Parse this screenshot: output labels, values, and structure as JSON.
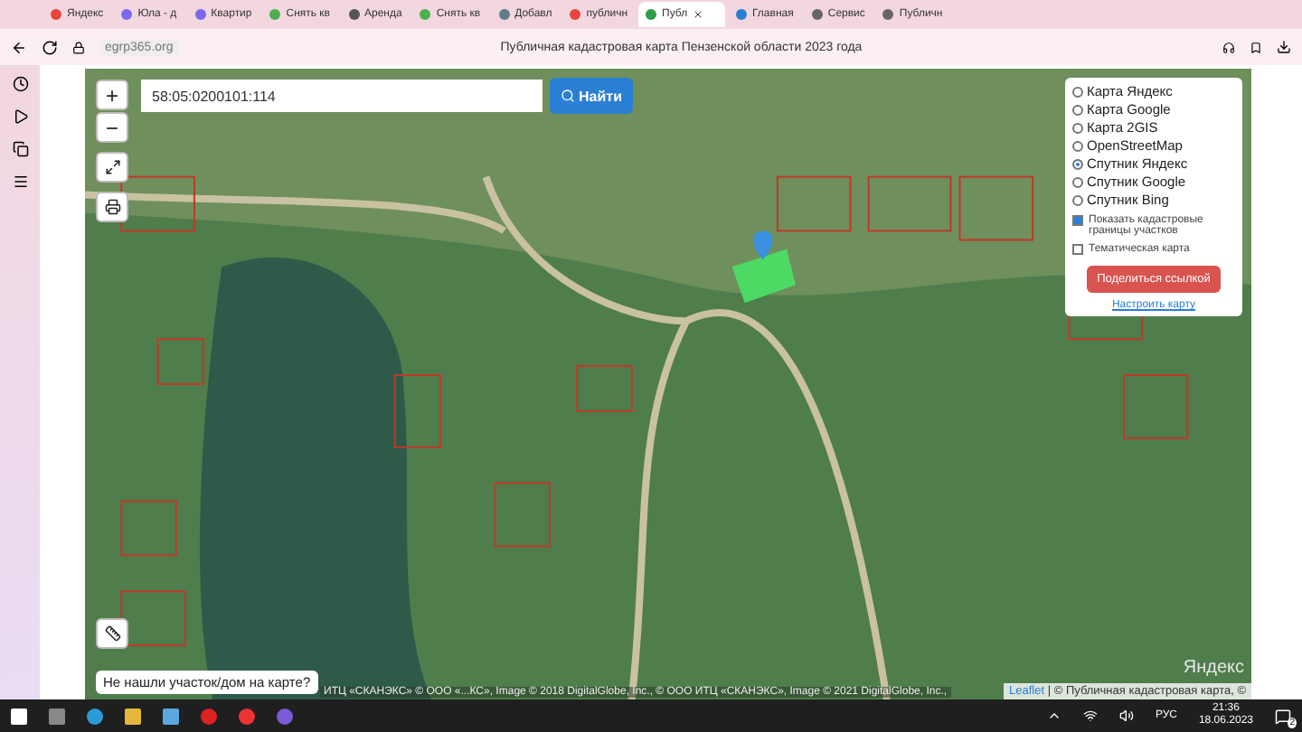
{
  "browser": {
    "tabs": [
      {
        "label": "Яндекс",
        "selected": false,
        "color": "#e8453c"
      },
      {
        "label": "Юла - д",
        "selected": false,
        "color": "#7b68ee"
      },
      {
        "label": "Квартир",
        "selected": false,
        "color": "#7b68ee"
      },
      {
        "label": "Снять кв",
        "selected": false,
        "color": "#4caf50"
      },
      {
        "label": "Аренда",
        "selected": false,
        "color": "#555555"
      },
      {
        "label": "Снять кв",
        "selected": false,
        "color": "#4caf50"
      },
      {
        "label": "Добавл",
        "selected": false,
        "color": "#607d8b"
      },
      {
        "label": "публичн",
        "selected": false,
        "color": "#e8453c"
      },
      {
        "label": "Публ",
        "selected": true,
        "color": "#2e9d4a"
      },
      {
        "label": "Главная",
        "selected": false,
        "color": "#2a7fd4"
      },
      {
        "label": "Сервис",
        "selected": false,
        "color": "#666666"
      },
      {
        "label": "Публичн",
        "selected": false,
        "color": "#666666"
      }
    ],
    "address": "egrp365.org",
    "page_title": "Публичная кадастровая карта Пензенской области 2023 года"
  },
  "map": {
    "search": {
      "value": "58:05:0200101:114",
      "button": "Найти"
    },
    "zoom_in": "+",
    "zoom_out": "−",
    "layers": [
      {
        "label": "Карта Яндекс",
        "selected": false
      },
      {
        "label": "Карта Google",
        "selected": false
      },
      {
        "label": "Карта 2GIS",
        "selected": false
      },
      {
        "label": "OpenStreetMap",
        "selected": false
      },
      {
        "label": "Спутник Яндекс",
        "selected": true
      },
      {
        "label": "Спутник Google",
        "selected": false
      },
      {
        "label": "Спутник Bing",
        "selected": false
      }
    ],
    "options": [
      {
        "label": "Показать кадастровые границы участков",
        "checked": true
      },
      {
        "label": "Тематическая карта",
        "checked": false
      }
    ],
    "share_button": "Поделиться ссылкой",
    "settings_link": "Настроить карту",
    "help_popup": "Не нашли участок/дом на карте?",
    "provider_logo": "Яндекс",
    "attribution_back": "ИТЦ «СКАНЭКС» © ООО «...КС», Image © 2018 DigitalGlobe, Inc., © ООО ИТЦ «СКАНЭКС», Image © 2021 DigitalGlobe, Inc.,",
    "attribution_link": "Leaflet",
    "attribution": "| © Публичная кадастровая карта, ©"
  },
  "taskbar": {
    "language": "РУС",
    "time": "21:36",
    "date": "18.06.2023",
    "notifications": "2"
  }
}
